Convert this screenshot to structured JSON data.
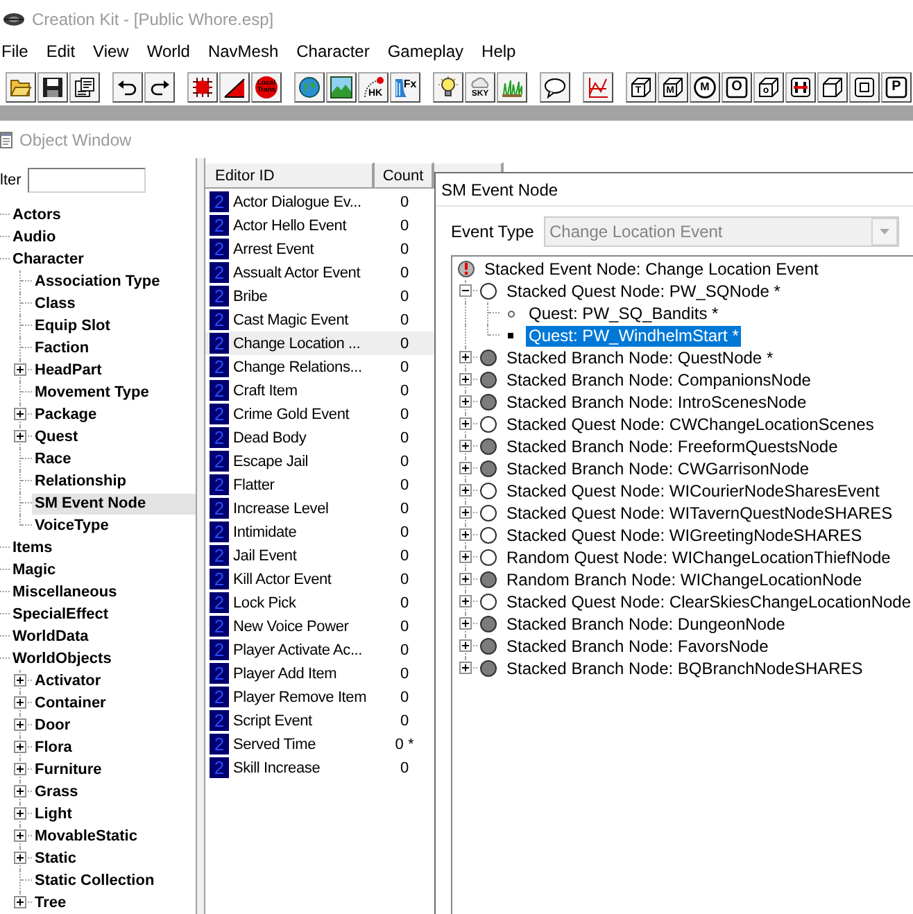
{
  "window": {
    "title": "Creation Kit - [Public Whore.esp]"
  },
  "menu": [
    "File",
    "Edit",
    "View",
    "World",
    "NavMesh",
    "Character",
    "Gameplay",
    "Help"
  ],
  "toolbar": [
    [
      {
        "kind": "open"
      },
      {
        "kind": "save"
      },
      {
        "kind": "properties"
      }
    ],
    [
      {
        "kind": "undo"
      },
      {
        "kind": "redo"
      }
    ],
    [
      {
        "kind": "grid"
      },
      {
        "kind": "angle"
      },
      {
        "kind": "localtrans",
        "glyph": "Local Trans"
      }
    ],
    [
      {
        "kind": "globe"
      },
      {
        "kind": "landscape"
      },
      {
        "kind": "havok",
        "glyph": "HK"
      },
      {
        "kind": "fx",
        "glyph": "Fx"
      }
    ],
    [
      {
        "kind": "bulb"
      },
      {
        "kind": "sky",
        "glyph": "SKY"
      },
      {
        "kind": "grass"
      }
    ],
    [
      {
        "kind": "speech"
      }
    ],
    [
      {
        "kind": "graph"
      }
    ],
    [
      {
        "kind": "cubeletter",
        "glyph": "T"
      },
      {
        "kind": "cubeletter",
        "glyph": "M"
      },
      {
        "kind": "circleletter",
        "glyph": "M"
      },
      {
        "kind": "boxletter",
        "glyph": "O"
      },
      {
        "kind": "cubeletter",
        "glyph": "o"
      },
      {
        "kind": "hframe"
      },
      {
        "kind": "cube"
      },
      {
        "kind": "nested"
      },
      {
        "kind": "boxletter",
        "glyph": "P"
      }
    ]
  ],
  "object_window": {
    "title": "Object Window",
    "filter": {
      "label": "lter"
    }
  },
  "object_tree": [
    {
      "label": "Actors",
      "selected": false
    },
    {
      "label": "Audio",
      "selected": false
    },
    {
      "label": "Character",
      "selected": false,
      "children": [
        {
          "label": "Association Type",
          "selected": false
        },
        {
          "label": "Class",
          "selected": false
        },
        {
          "label": "Equip Slot",
          "selected": false
        },
        {
          "label": "Faction",
          "selected": false
        },
        {
          "label": "HeadPart",
          "selected": false,
          "expanded": false
        },
        {
          "label": "Movement Type",
          "selected": false
        },
        {
          "label": "Package",
          "selected": false,
          "expanded": false
        },
        {
          "label": "Quest",
          "selected": false,
          "expanded": false
        },
        {
          "label": "Race",
          "selected": false
        },
        {
          "label": "Relationship",
          "selected": false
        },
        {
          "label": "SM Event Node",
          "selected": true
        },
        {
          "label": "VoiceType",
          "selected": false
        }
      ]
    },
    {
      "label": "Items",
      "selected": false
    },
    {
      "label": "Magic",
      "selected": false
    },
    {
      "label": "Miscellaneous",
      "selected": false
    },
    {
      "label": "SpecialEffect",
      "selected": false
    },
    {
      "label": "WorldData",
      "selected": false
    },
    {
      "label": "WorldObjects",
      "selected": false,
      "children": [
        {
          "label": "Activator",
          "selected": false,
          "expanded": false
        },
        {
          "label": "Container",
          "selected": false,
          "expanded": false
        },
        {
          "label": "Door",
          "selected": false,
          "expanded": false
        },
        {
          "label": "Flora",
          "selected": false,
          "expanded": false
        },
        {
          "label": "Furniture",
          "selected": false,
          "expanded": false
        },
        {
          "label": "Grass",
          "selected": false,
          "expanded": false
        },
        {
          "label": "Light",
          "selected": false,
          "expanded": false
        },
        {
          "label": "MovableStatic",
          "selected": false,
          "expanded": false
        },
        {
          "label": "Static",
          "selected": false,
          "expanded": false
        },
        {
          "label": "Static Collection",
          "selected": false
        },
        {
          "label": "Tree",
          "selected": false,
          "expanded": false
        }
      ]
    }
  ],
  "record_list": {
    "columns": [
      "Editor ID",
      "Count"
    ],
    "rows": [
      {
        "icon": "2",
        "editor_id": "Actor Dialogue Ev...",
        "count": "0",
        "selected": false
      },
      {
        "icon": "2",
        "editor_id": "Actor Hello Event",
        "count": "0",
        "selected": false
      },
      {
        "icon": "2",
        "editor_id": "Arrest Event",
        "count": "0",
        "selected": false
      },
      {
        "icon": "2",
        "editor_id": "Assualt Actor Event",
        "count": "0",
        "selected": false
      },
      {
        "icon": "2",
        "editor_id": "Bribe",
        "count": "0",
        "selected": false
      },
      {
        "icon": "2",
        "editor_id": "Cast Magic Event",
        "count": "0",
        "selected": false
      },
      {
        "icon": "2",
        "editor_id": "Change Location ...",
        "count": "0",
        "selected": true
      },
      {
        "icon": "2",
        "editor_id": "Change Relations...",
        "count": "0",
        "selected": false
      },
      {
        "icon": "2",
        "editor_id": "Craft Item",
        "count": "0",
        "selected": false
      },
      {
        "icon": "2",
        "editor_id": "Crime Gold Event",
        "count": "0",
        "selected": false
      },
      {
        "icon": "2",
        "editor_id": "Dead Body",
        "count": "0",
        "selected": false
      },
      {
        "icon": "2",
        "editor_id": "Escape Jail",
        "count": "0",
        "selected": false
      },
      {
        "icon": "2",
        "editor_id": "Flatter",
        "count": "0",
        "selected": false
      },
      {
        "icon": "2",
        "editor_id": "Increase Level",
        "count": "0",
        "selected": false
      },
      {
        "icon": "2",
        "editor_id": "Intimidate",
        "count": "0",
        "selected": false
      },
      {
        "icon": "2",
        "editor_id": "Jail Event",
        "count": "0",
        "selected": false
      },
      {
        "icon": "2",
        "editor_id": "Kill Actor Event",
        "count": "0",
        "selected": false
      },
      {
        "icon": "2",
        "editor_id": "Lock Pick",
        "count": "0",
        "selected": false
      },
      {
        "icon": "2",
        "editor_id": "New Voice Power",
        "count": "0",
        "selected": false
      },
      {
        "icon": "2",
        "editor_id": "Player Activate Ac...",
        "count": "0",
        "selected": false
      },
      {
        "icon": "2",
        "editor_id": "Player Add Item",
        "count": "0",
        "selected": false
      },
      {
        "icon": "2",
        "editor_id": "Player Remove Item",
        "count": "0",
        "selected": false
      },
      {
        "icon": "2",
        "editor_id": "Script Event",
        "count": "0",
        "selected": false
      },
      {
        "icon": "2",
        "editor_id": "Served Time",
        "count": "0 *",
        "selected": false
      },
      {
        "icon": "2",
        "editor_id": "Skill Increase",
        "count": "0",
        "selected": false
      }
    ]
  },
  "sm_event_node": {
    "title": "SM Event Node",
    "event_type": {
      "label": "Event Type",
      "value": "Change Location Event",
      "disabled": true
    },
    "tree": [
      {
        "kind": "event",
        "label": "Stacked Event Node: Change Location Event",
        "selected": false,
        "children": [
          {
            "kind": "questnode",
            "label": "Stacked Quest Node: PW_SQNode *",
            "expanded": true,
            "selected": false,
            "children": [
              {
                "kind": "questdot",
                "label": "Quest: PW_SQ_Bandits *",
                "selected": false
              },
              {
                "kind": "questsquare",
                "label": "Quest: PW_WindhelmStart *",
                "selected": true
              }
            ]
          },
          {
            "kind": "branchnode",
            "label": "Stacked Branch Node: QuestNode *",
            "expanded": false,
            "selected": false
          },
          {
            "kind": "branchnode",
            "label": "Stacked Branch Node: CompanionsNode",
            "expanded": false,
            "selected": false
          },
          {
            "kind": "branchnode",
            "label": "Stacked Branch Node: IntroScenesNode",
            "expanded": false,
            "selected": false
          },
          {
            "kind": "questnode",
            "label": "Stacked Quest Node: CWChangeLocationScenes",
            "expanded": false,
            "selected": false
          },
          {
            "kind": "branchnode",
            "label": "Stacked Branch Node: FreeformQuestsNode",
            "expanded": false,
            "selected": false
          },
          {
            "kind": "branchnode",
            "label": "Stacked Branch Node: CWGarrisonNode",
            "expanded": false,
            "selected": false
          },
          {
            "kind": "questnode",
            "label": "Stacked Quest Node: WICourierNodeSharesEvent",
            "expanded": false,
            "selected": false
          },
          {
            "kind": "questnode",
            "label": "Stacked Quest Node: WITavernQuestNodeSHARES",
            "expanded": false,
            "selected": false
          },
          {
            "kind": "questnode",
            "label": "Stacked Quest Node: WIGreetingNodeSHARES",
            "expanded": false,
            "selected": false
          },
          {
            "kind": "questnode",
            "label": "Random Quest Node: WIChangeLocationThiefNode",
            "expanded": false,
            "selected": false
          },
          {
            "kind": "branchnode",
            "label": "Random Branch Node: WIChangeLocationNode",
            "expanded": false,
            "selected": false
          },
          {
            "kind": "questnode",
            "label": "Stacked Quest Node: ClearSkiesChangeLocationNode",
            "expanded": false,
            "selected": false
          },
          {
            "kind": "branchnode",
            "label": "Stacked Branch Node: DungeonNode",
            "expanded": false,
            "selected": false
          },
          {
            "kind": "branchnode",
            "label": "Stacked Branch Node: FavorsNode",
            "expanded": false,
            "selected": false
          },
          {
            "kind": "branchnode",
            "label": "Stacked Branch Node: BQBranchNodeSHARES",
            "expanded": false,
            "selected": false
          }
        ]
      }
    ]
  }
}
